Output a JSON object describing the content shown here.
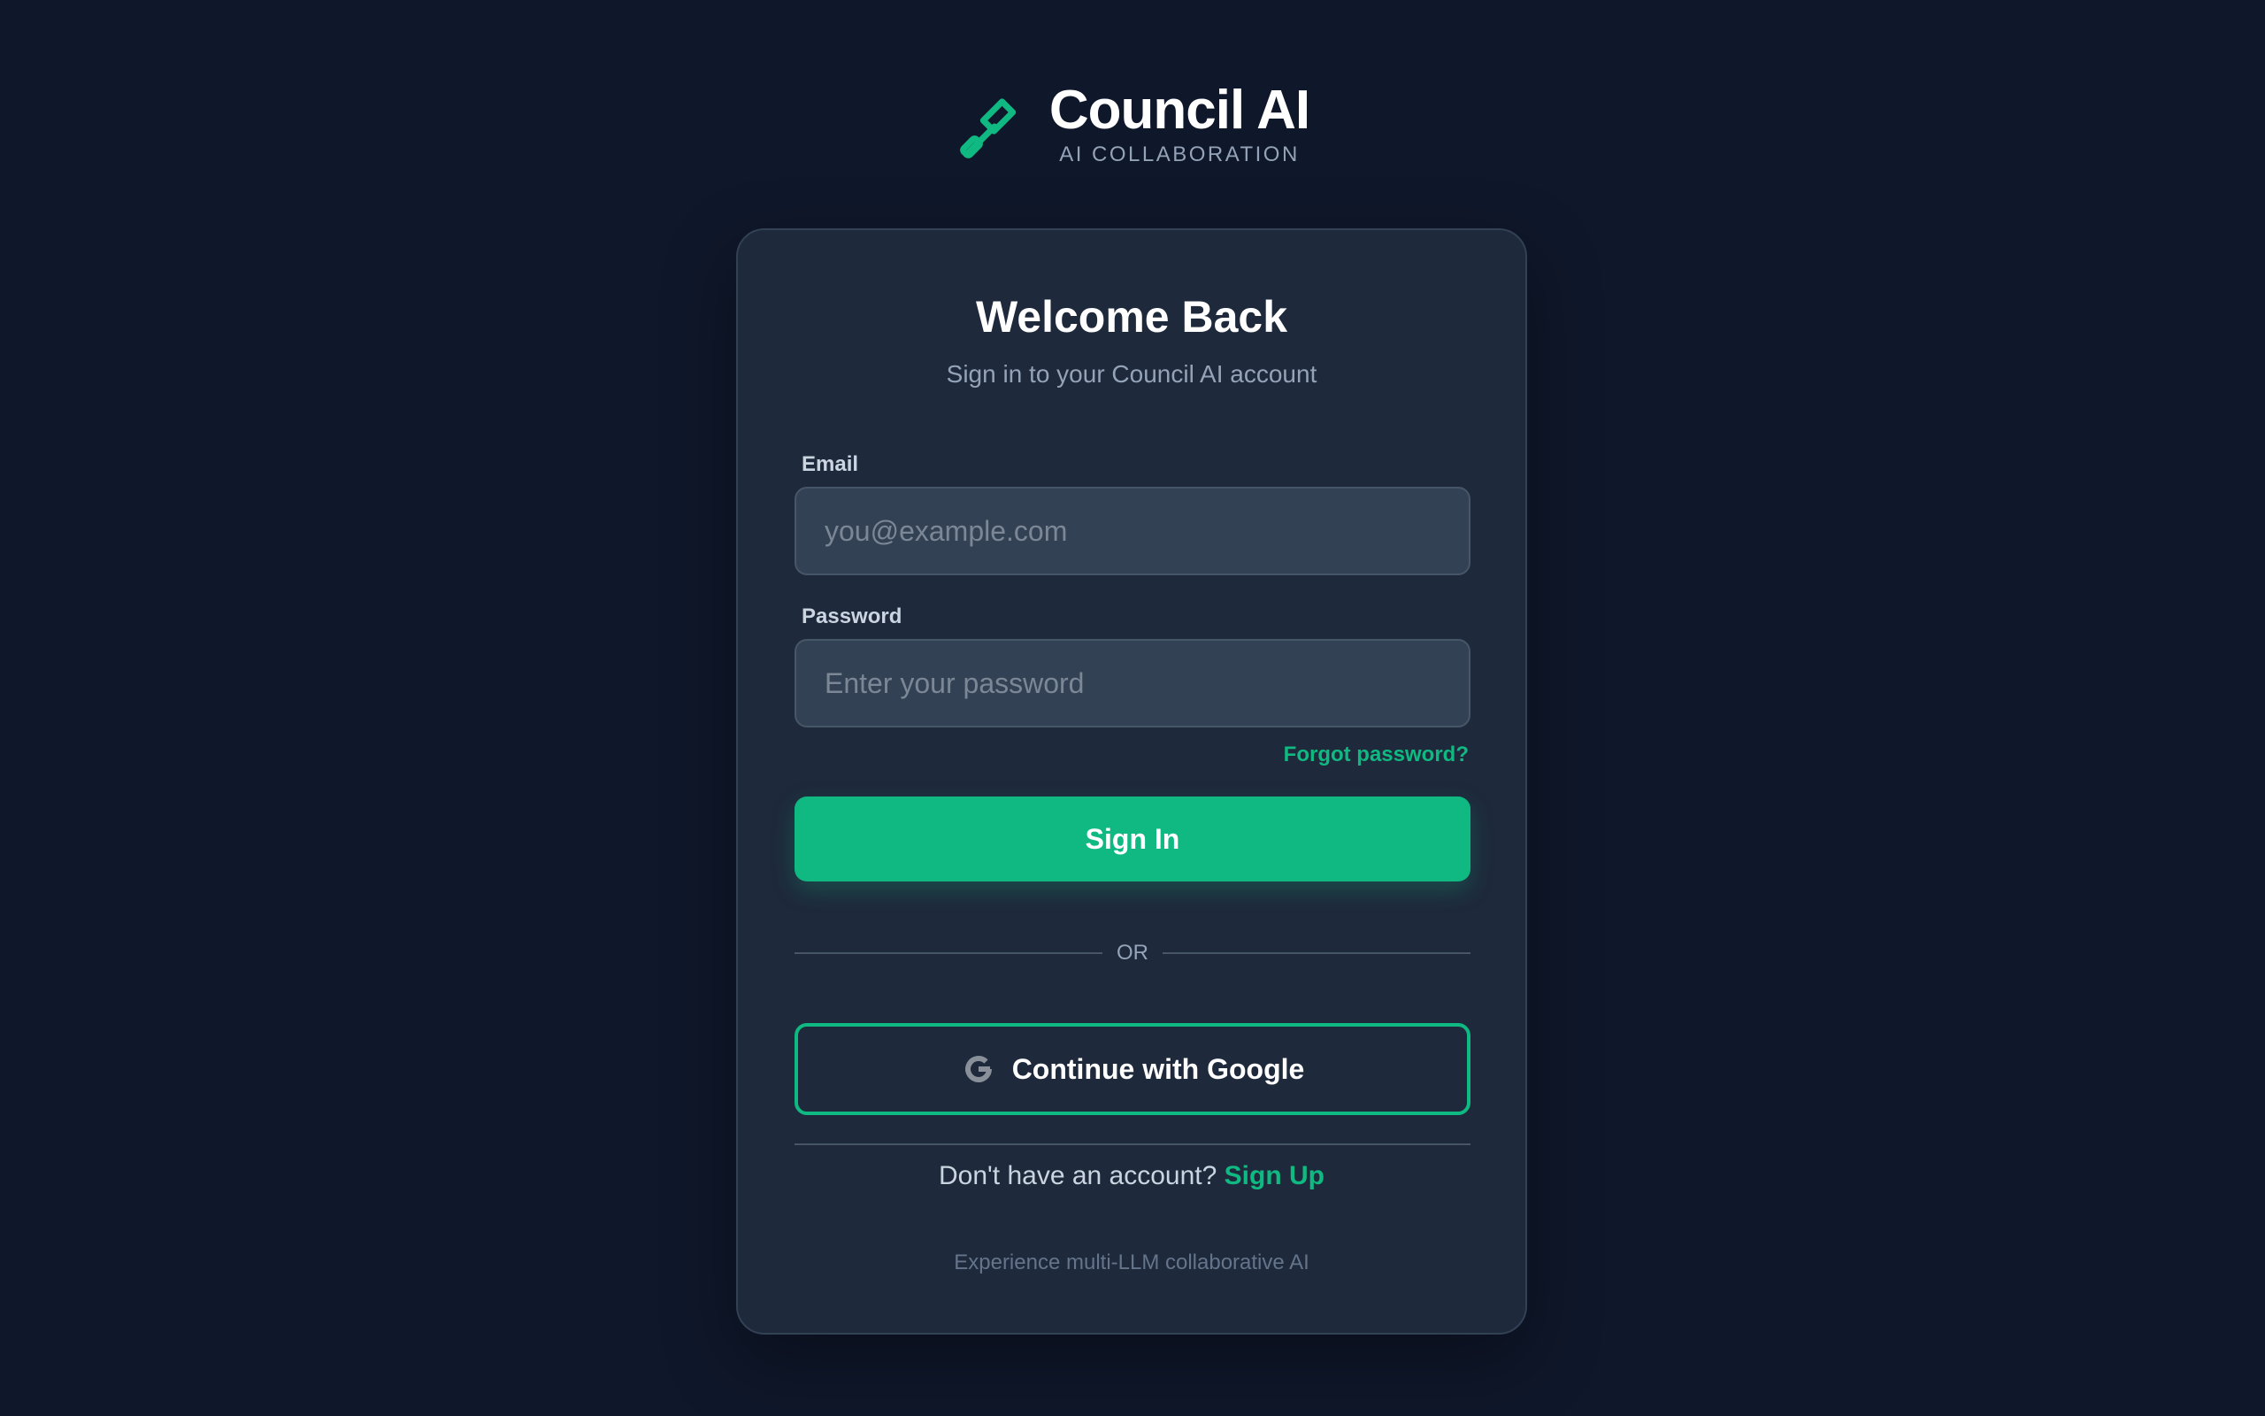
{
  "brand": {
    "title": "Council AI",
    "subtitle": "AI COLLABORATION",
    "logo_icon": "gavel-icon",
    "accent_color": "#10b981"
  },
  "card": {
    "title": "Welcome Back",
    "subtitle": "Sign in to your Council AI account"
  },
  "form": {
    "email_label": "Email",
    "email_placeholder": "you@example.com",
    "email_value": "",
    "password_label": "Password",
    "password_placeholder": "Enter your password",
    "password_value": "",
    "forgot_label": "Forgot password?",
    "signin_label": "Sign In"
  },
  "divider": {
    "label": "OR"
  },
  "google": {
    "label": "Continue with Google",
    "icon": "google-icon"
  },
  "signup": {
    "prompt": "Don't have an account?",
    "link": "Sign Up"
  },
  "footer": {
    "note": "Experience multi-LLM collaborative AI"
  }
}
